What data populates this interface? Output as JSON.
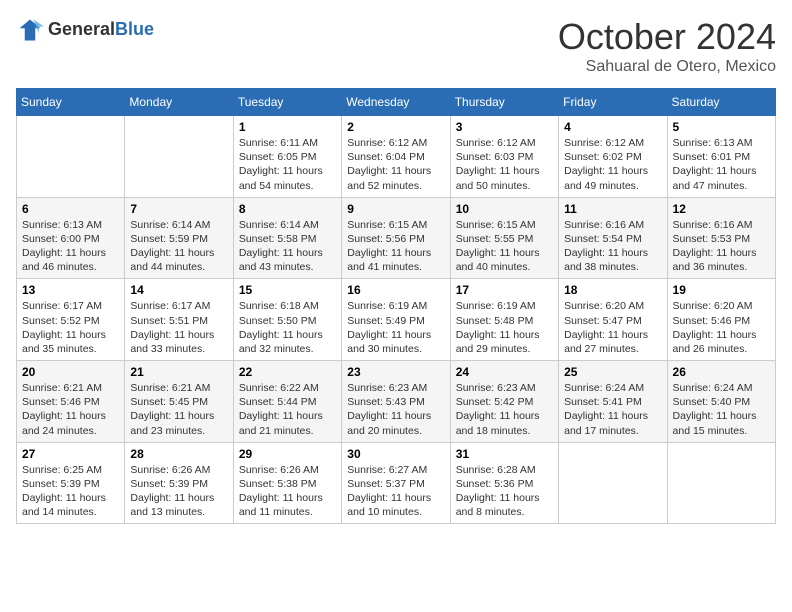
{
  "header": {
    "logo_general": "General",
    "logo_blue": "Blue",
    "month": "October 2024",
    "location": "Sahuaral de Otero, Mexico"
  },
  "weekdays": [
    "Sunday",
    "Monday",
    "Tuesday",
    "Wednesday",
    "Thursday",
    "Friday",
    "Saturday"
  ],
  "weeks": [
    [
      {
        "day": "",
        "info": ""
      },
      {
        "day": "",
        "info": ""
      },
      {
        "day": "1",
        "info": "Sunrise: 6:11 AM\nSunset: 6:05 PM\nDaylight: 11 hours and 54 minutes."
      },
      {
        "day": "2",
        "info": "Sunrise: 6:12 AM\nSunset: 6:04 PM\nDaylight: 11 hours and 52 minutes."
      },
      {
        "day": "3",
        "info": "Sunrise: 6:12 AM\nSunset: 6:03 PM\nDaylight: 11 hours and 50 minutes."
      },
      {
        "day": "4",
        "info": "Sunrise: 6:12 AM\nSunset: 6:02 PM\nDaylight: 11 hours and 49 minutes."
      },
      {
        "day": "5",
        "info": "Sunrise: 6:13 AM\nSunset: 6:01 PM\nDaylight: 11 hours and 47 minutes."
      }
    ],
    [
      {
        "day": "6",
        "info": "Sunrise: 6:13 AM\nSunset: 6:00 PM\nDaylight: 11 hours and 46 minutes."
      },
      {
        "day": "7",
        "info": "Sunrise: 6:14 AM\nSunset: 5:59 PM\nDaylight: 11 hours and 44 minutes."
      },
      {
        "day": "8",
        "info": "Sunrise: 6:14 AM\nSunset: 5:58 PM\nDaylight: 11 hours and 43 minutes."
      },
      {
        "day": "9",
        "info": "Sunrise: 6:15 AM\nSunset: 5:56 PM\nDaylight: 11 hours and 41 minutes."
      },
      {
        "day": "10",
        "info": "Sunrise: 6:15 AM\nSunset: 5:55 PM\nDaylight: 11 hours and 40 minutes."
      },
      {
        "day": "11",
        "info": "Sunrise: 6:16 AM\nSunset: 5:54 PM\nDaylight: 11 hours and 38 minutes."
      },
      {
        "day": "12",
        "info": "Sunrise: 6:16 AM\nSunset: 5:53 PM\nDaylight: 11 hours and 36 minutes."
      }
    ],
    [
      {
        "day": "13",
        "info": "Sunrise: 6:17 AM\nSunset: 5:52 PM\nDaylight: 11 hours and 35 minutes."
      },
      {
        "day": "14",
        "info": "Sunrise: 6:17 AM\nSunset: 5:51 PM\nDaylight: 11 hours and 33 minutes."
      },
      {
        "day": "15",
        "info": "Sunrise: 6:18 AM\nSunset: 5:50 PM\nDaylight: 11 hours and 32 minutes."
      },
      {
        "day": "16",
        "info": "Sunrise: 6:19 AM\nSunset: 5:49 PM\nDaylight: 11 hours and 30 minutes."
      },
      {
        "day": "17",
        "info": "Sunrise: 6:19 AM\nSunset: 5:48 PM\nDaylight: 11 hours and 29 minutes."
      },
      {
        "day": "18",
        "info": "Sunrise: 6:20 AM\nSunset: 5:47 PM\nDaylight: 11 hours and 27 minutes."
      },
      {
        "day": "19",
        "info": "Sunrise: 6:20 AM\nSunset: 5:46 PM\nDaylight: 11 hours and 26 minutes."
      }
    ],
    [
      {
        "day": "20",
        "info": "Sunrise: 6:21 AM\nSunset: 5:46 PM\nDaylight: 11 hours and 24 minutes."
      },
      {
        "day": "21",
        "info": "Sunrise: 6:21 AM\nSunset: 5:45 PM\nDaylight: 11 hours and 23 minutes."
      },
      {
        "day": "22",
        "info": "Sunrise: 6:22 AM\nSunset: 5:44 PM\nDaylight: 11 hours and 21 minutes."
      },
      {
        "day": "23",
        "info": "Sunrise: 6:23 AM\nSunset: 5:43 PM\nDaylight: 11 hours and 20 minutes."
      },
      {
        "day": "24",
        "info": "Sunrise: 6:23 AM\nSunset: 5:42 PM\nDaylight: 11 hours and 18 minutes."
      },
      {
        "day": "25",
        "info": "Sunrise: 6:24 AM\nSunset: 5:41 PM\nDaylight: 11 hours and 17 minutes."
      },
      {
        "day": "26",
        "info": "Sunrise: 6:24 AM\nSunset: 5:40 PM\nDaylight: 11 hours and 15 minutes."
      }
    ],
    [
      {
        "day": "27",
        "info": "Sunrise: 6:25 AM\nSunset: 5:39 PM\nDaylight: 11 hours and 14 minutes."
      },
      {
        "day": "28",
        "info": "Sunrise: 6:26 AM\nSunset: 5:39 PM\nDaylight: 11 hours and 13 minutes."
      },
      {
        "day": "29",
        "info": "Sunrise: 6:26 AM\nSunset: 5:38 PM\nDaylight: 11 hours and 11 minutes."
      },
      {
        "day": "30",
        "info": "Sunrise: 6:27 AM\nSunset: 5:37 PM\nDaylight: 11 hours and 10 minutes."
      },
      {
        "day": "31",
        "info": "Sunrise: 6:28 AM\nSunset: 5:36 PM\nDaylight: 11 hours and 8 minutes."
      },
      {
        "day": "",
        "info": ""
      },
      {
        "day": "",
        "info": ""
      }
    ]
  ]
}
